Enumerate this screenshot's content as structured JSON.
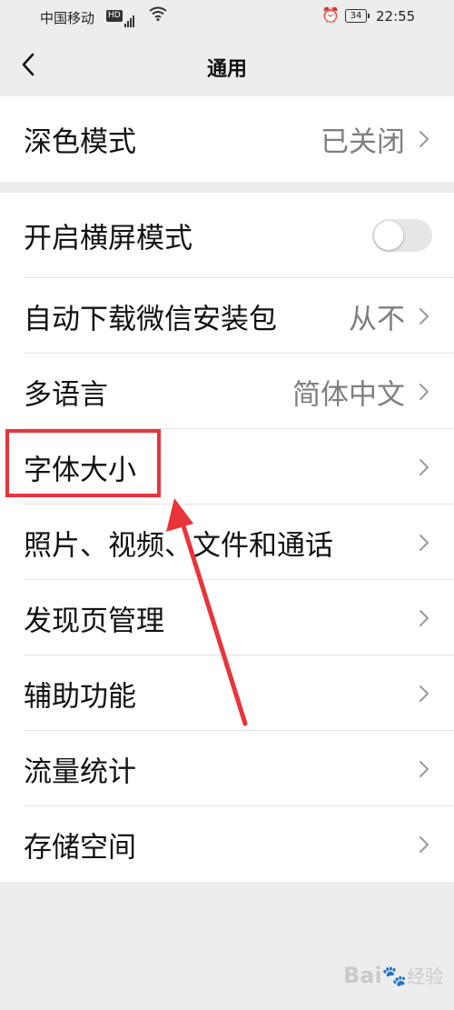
{
  "status_bar": {
    "carrier": "中国移动",
    "network_badge": "HD",
    "network_gen": "4G",
    "battery": "34",
    "time": "22:55"
  },
  "nav": {
    "title": "通用"
  },
  "groups": [
    {
      "items": [
        {
          "label": "深色模式",
          "value": "已关闭"
        }
      ]
    },
    {
      "items": [
        {
          "label": "开启横屏模式",
          "toggle": false
        },
        {
          "label": "自动下载微信安装包",
          "value": "从不"
        },
        {
          "label": "多语言",
          "value": "简体中文"
        },
        {
          "label": "字体大小",
          "value": ""
        },
        {
          "label": "照片、视频、文件和通话",
          "value": ""
        },
        {
          "label": "发现页管理",
          "value": ""
        },
        {
          "label": "辅助功能",
          "value": ""
        },
        {
          "label": "流量统计",
          "value": ""
        },
        {
          "label": "存储空间",
          "value": ""
        }
      ]
    }
  ],
  "annotation": {
    "highlight_color": "#e8343b"
  },
  "watermark": {
    "brand": "Bai",
    "brand_suffix": "经验"
  }
}
